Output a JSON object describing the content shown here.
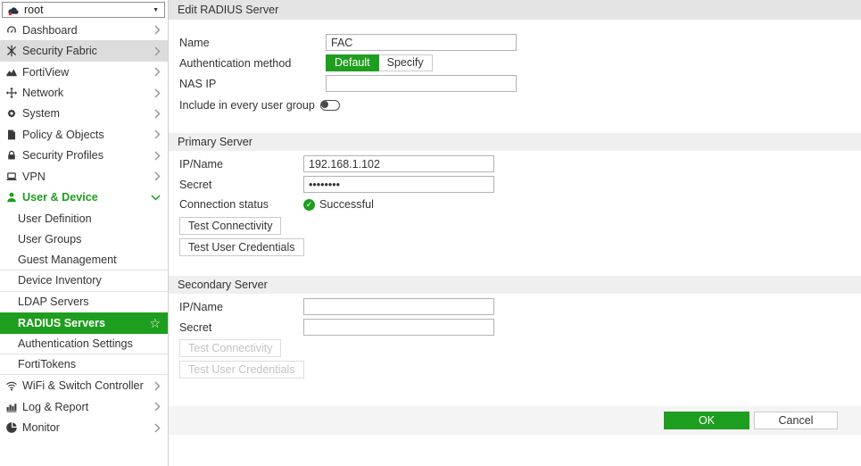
{
  "colors": {
    "accent_green": "#1e9e1e",
    "sidebar_hover": "#dcdcdc",
    "titlebar_bg": "#e4e4e4",
    "section_bg": "#efefef",
    "footer_bg": "#f4f4f4"
  },
  "icons": {
    "check": "✓",
    "star": "☆",
    "caret_down": "▼"
  },
  "vdom_selector": {
    "value": "root"
  },
  "sidebar": {
    "items": [
      {
        "label": "Dashboard"
      },
      {
        "label": "Security Fabric"
      },
      {
        "label": "FortiView"
      },
      {
        "label": "Network"
      },
      {
        "label": "System"
      },
      {
        "label": "Policy & Objects"
      },
      {
        "label": "Security Profiles"
      },
      {
        "label": "VPN"
      },
      {
        "label": "User & Device"
      },
      {
        "label": "User Definition"
      },
      {
        "label": "User Groups"
      },
      {
        "label": "Guest Management"
      },
      {
        "label": "Device Inventory"
      },
      {
        "label": "LDAP Servers"
      },
      {
        "label": "RADIUS Servers"
      },
      {
        "label": "Authentication Settings"
      },
      {
        "label": "FortiTokens"
      },
      {
        "label": "WiFi & Switch Controller"
      },
      {
        "label": "Log & Report"
      },
      {
        "label": "Monitor"
      }
    ]
  },
  "header": {
    "title": "Edit RADIUS Server"
  },
  "form": {
    "name": {
      "label": "Name",
      "value": "FAC"
    },
    "auth_method": {
      "label": "Authentication method",
      "options": [
        "Default",
        "Specify"
      ],
      "selected": "Default"
    },
    "nas_ip": {
      "label": "NAS IP",
      "value": ""
    },
    "include_group": {
      "label": "Include in every user group",
      "enabled": false
    }
  },
  "primary_server": {
    "title": "Primary Server",
    "ip_name": {
      "label": "IP/Name",
      "value": "192.168.1.102"
    },
    "secret": {
      "label": "Secret",
      "value": "••••••••"
    },
    "connection_status": {
      "label": "Connection status",
      "value": "Successful"
    },
    "buttons": {
      "test_connectivity": "Test Connectivity",
      "test_user_credentials": "Test User Credentials"
    }
  },
  "secondary_server": {
    "title": "Secondary Server",
    "ip_name": {
      "label": "IP/Name",
      "value": ""
    },
    "secret": {
      "label": "Secret",
      "value": ""
    },
    "buttons": {
      "test_connectivity": "Test Connectivity",
      "test_user_credentials": "Test User Credentials"
    }
  },
  "footer": {
    "ok": "OK",
    "cancel": "Cancel"
  }
}
